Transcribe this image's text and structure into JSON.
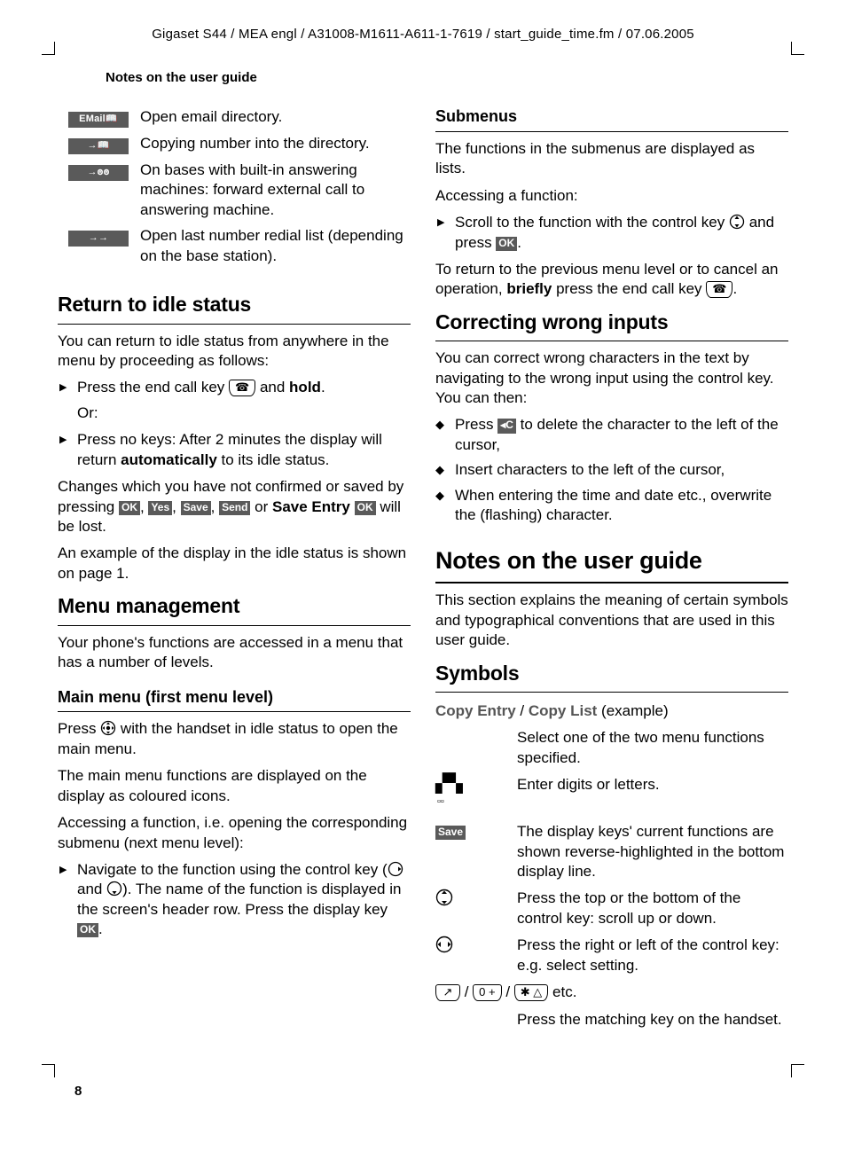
{
  "running_head": "Gigaset S44 / MEA engl / A31008-M1611-A611-1-7619 / start_guide_time.fm / 07.06.2005",
  "section_title": "Notes on the user guide",
  "page_number": "8",
  "left": {
    "icon_rows": [
      {
        "glyph": "EMail📖",
        "text": "Open email directory."
      },
      {
        "glyph": "→📖",
        "text": "Copying number into the directory."
      },
      {
        "glyph": "→ꙩꙩ",
        "text": "On bases with built-in answering machines: forward external call to answering machine."
      },
      {
        "glyph": "→→",
        "text": "Open last number redial list (depending on the base station)."
      }
    ],
    "h_return": "Return to idle status",
    "p_return_intro": "You can return to idle status from anywhere in the menu by proceeding as follows:",
    "li_return_1a": "Press the end call key ",
    "li_return_1b": " and ",
    "li_return_1c": "hold",
    "li_return_1d": ".",
    "p_or": "Or:",
    "li_return_2a": "Press no keys: After 2 minutes the display will return ",
    "li_return_2b": "automatically",
    "li_return_2c": " to its idle status.",
    "p_changes_a": "Changes which you have not confirmed or saved by pressing ",
    "p_changes_b": " or ",
    "p_changes_c": "Save Entry",
    "p_changes_d": " will be lost.",
    "ok_labels": {
      "ok": "OK",
      "yes": "Yes",
      "save": "Save",
      "send": "Send"
    },
    "p_example": "An example of the display in the idle status is shown on page 1.",
    "h_menu": "Menu management",
    "p_menu_intro": "Your phone's functions are accessed in a menu that has a number of levels.",
    "sh_main": "Main menu (first menu level)",
    "p_main_1a": "Press ",
    "p_main_1b": " with the handset in idle status to open the main menu.",
    "p_main_2": "The main menu functions are displayed on the display as coloured icons.",
    "p_main_3": "Accessing a function, i.e. opening the corresponding submenu (next menu level):",
    "li_main_a": "Navigate to the function using the control key (",
    "li_main_b": " and ",
    "li_main_c": "). The name of the function is displayed in the screen's header row. Press the display key "
  },
  "right": {
    "sh_sub": "Submenus",
    "p_sub_1": "The functions in the submenus are displayed as lists.",
    "p_sub_2": "Accessing a function:",
    "li_sub_a": "Scroll to the function with the control key ",
    "li_sub_b": " and press ",
    "p_sub_ret_a": "To return to the previous menu level or to cancel an operation, ",
    "p_sub_ret_b": "briefly",
    "p_sub_ret_c": " press the end call key ",
    "h_correct": "Correcting wrong inputs",
    "p_correct_intro": "You can correct wrong characters in the text by navigating to the wrong input using the control key. You can then:",
    "li_c1a": "Press ",
    "li_c1b": " to delete the character to the left of the cursor,",
    "c_label": "◂C",
    "li_c2": "Insert characters to the left of the cursor,",
    "li_c3": "When entering the time and date etc., overwrite the (flashing) character.",
    "h_notes": "Notes on the user guide",
    "p_notes": "This section explains the meaning of certain symbols and typographical conventions that are used in this user guide.",
    "h_symbols": "Symbols",
    "sym_copy_a": "Copy Entry",
    "sym_copy_sep": " / ",
    "sym_copy_b": "Copy List",
    "sym_copy_c": " (example)",
    "sym_copy_desc": "Select one of the two menu functions specified.",
    "sym_digits_glyph": "⁂",
    "sym_digits": "Enter digits or letters.",
    "sym_save_label": "Save",
    "sym_save": "The display keys' current functions are shown reverse-highlighted in the bottom display line.",
    "sym_updown": "Press the top or the bottom of the control key: scroll up or down.",
    "sym_leftright": "Press the right or left of the control key: e.g. select setting.",
    "sym_keys_sep": " / ",
    "sym_keys_etc": " etc.",
    "sym_keys_desc": "Press the matching key on the handset.",
    "key_0": "0 +",
    "key_star": "✱ △"
  }
}
